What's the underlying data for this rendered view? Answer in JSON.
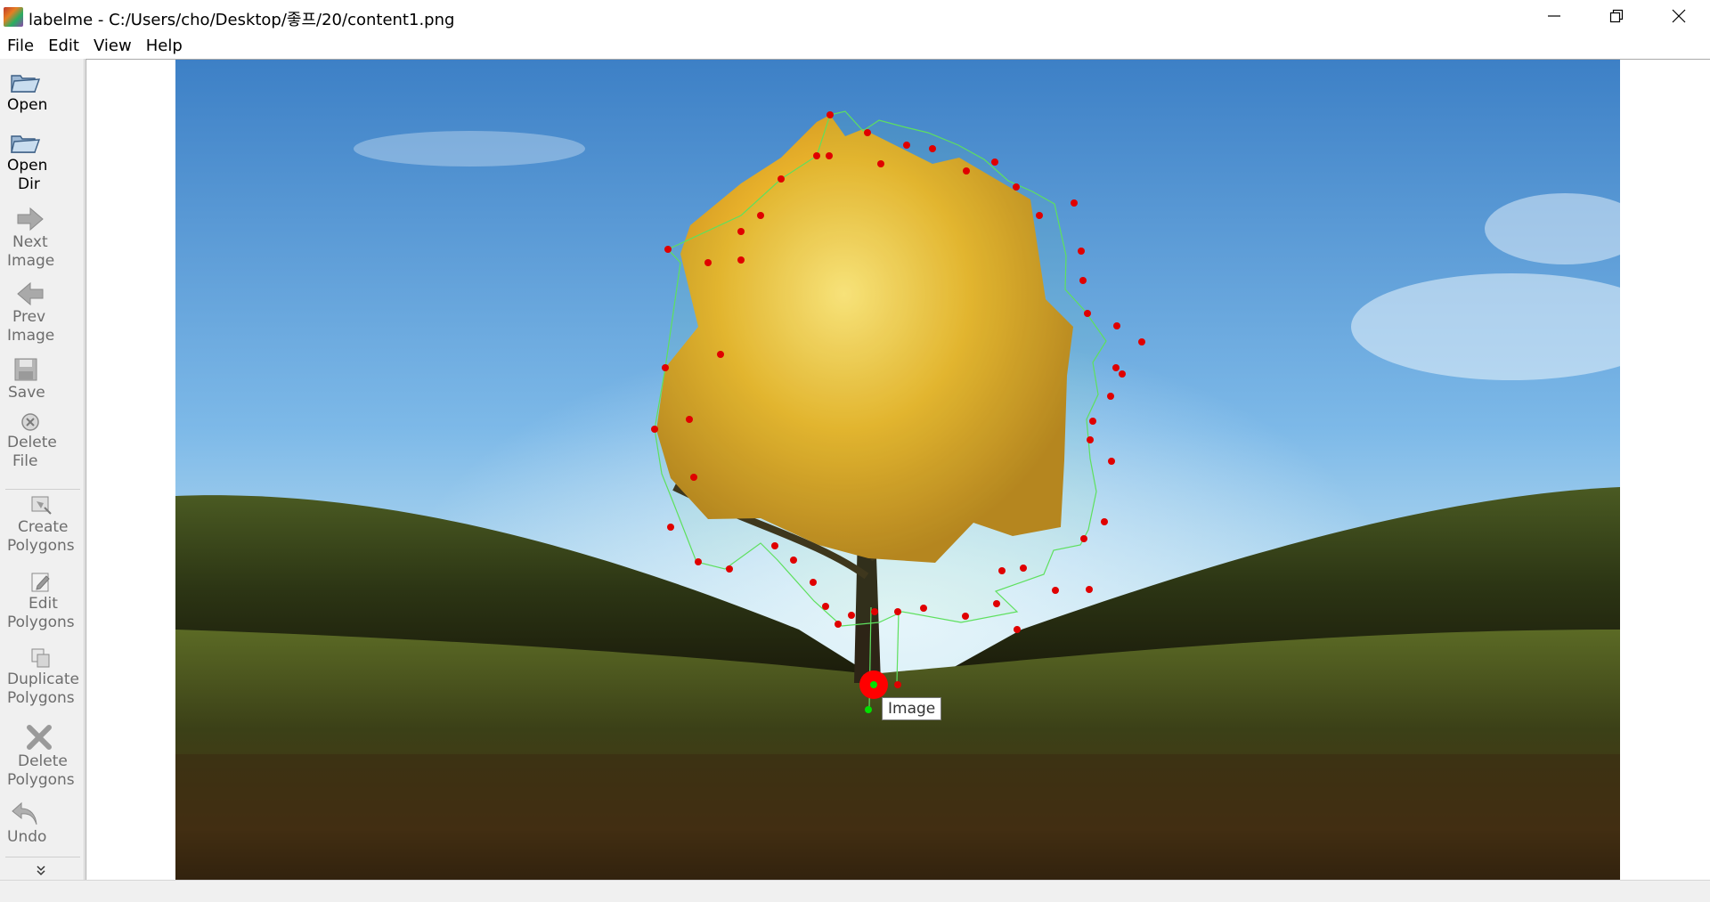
{
  "window": {
    "title": "labelme - C:/Users/cho/Desktop/좋프/20/content1.png",
    "controls": [
      "minimize-icon",
      "restore-icon",
      "close-icon"
    ]
  },
  "menu": [
    "File",
    "Edit",
    "View",
    "Help"
  ],
  "toolbar": {
    "open": {
      "line1": "Open",
      "line2": "",
      "icon": "folder-open-icon",
      "enabled": true
    },
    "open_dir": {
      "line1": "Open",
      "line2": "Dir",
      "icon": "folder-open-icon",
      "enabled": true
    },
    "next_image": {
      "line1": "Next",
      "line2": "Image",
      "icon": "arrow-right-icon",
      "enabled": false
    },
    "prev_image": {
      "line1": "Prev",
      "line2": "Image",
      "icon": "arrow-left-icon",
      "enabled": false
    },
    "save": {
      "line1": "Save",
      "line2": "",
      "icon": "floppy-disk-icon",
      "enabled": false
    },
    "delete_file": {
      "line1": "Delete",
      "line2": "File",
      "icon": "circle-x-icon",
      "enabled": false
    },
    "create_polygons": {
      "line1": "Create",
      "line2": "Polygons",
      "icon": "create-polygon-icon",
      "enabled": false
    },
    "edit_polygons": {
      "line1": "Edit",
      "line2": "Polygons",
      "icon": "edit-icon",
      "enabled": false
    },
    "duplicate_polygons": {
      "line1": "Duplicate",
      "line2": "Polygons",
      "icon": "duplicate-icon",
      "enabled": false
    },
    "delete_polygons": {
      "line1": "Delete",
      "line2": "Polygons",
      "icon": "delete-x-icon",
      "enabled": false
    },
    "undo": {
      "line1": "Undo",
      "line2": "",
      "icon": "undo-icon",
      "enabled": false
    },
    "more": {
      "icon": "chevron-double-down-icon"
    }
  },
  "canvas": {
    "tooltip": "Image",
    "colors": {
      "polygon_line": "#5ee05e",
      "vertex": "#e00000",
      "highlight_vertex": "#ff0000",
      "cursor_point": "#00e000"
    }
  }
}
